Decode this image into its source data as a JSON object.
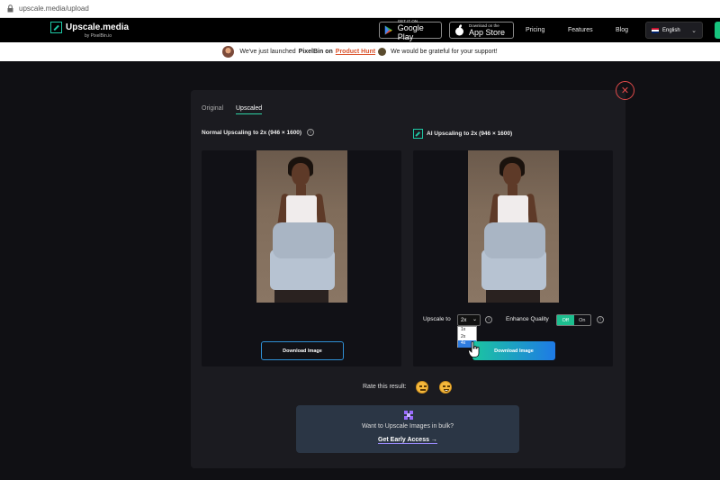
{
  "browser": {
    "url": "upscale.media/upload"
  },
  "navbar": {
    "brand": "Upscale.media",
    "byline": "by PixelBin.io",
    "google_play_small": "GET IT ON",
    "google_play_big": "Google Play",
    "app_store_small": "Download on the",
    "app_store_big": "App Store",
    "links": [
      "Pricing",
      "Features",
      "Blog"
    ],
    "language": "English"
  },
  "banner": {
    "prefix": "We've just launched",
    "pixelbin": "PixelBin on",
    "product_hunt": "Product Hunt",
    "suffix": "We would be grateful for your support!"
  },
  "tabs": [
    "Original",
    "Upscaled"
  ],
  "left": {
    "title": "Normal Upscaling to 2x (946 × 1600)",
    "download_label": "Download Image"
  },
  "right": {
    "title": "AI Upscaling to 2x (946 × 1600)",
    "download_label": "Download Image",
    "upscale_label": "Upscale to",
    "upscale_value": "2x",
    "upscale_options": [
      "1x",
      "2x",
      "4x"
    ],
    "enhance_label": "Enhance Quality",
    "toggle_off": "Off",
    "toggle_on": "On"
  },
  "rating": {
    "label": "Rate this result:"
  },
  "bulk": {
    "question": "Want to Upscale Images in bulk?",
    "cta": "Get Early Access →"
  },
  "colors": {
    "accent": "#1ec8a5",
    "blue": "#1e7ae6",
    "close": "#e04a4a",
    "product_hunt": "#da552f"
  }
}
